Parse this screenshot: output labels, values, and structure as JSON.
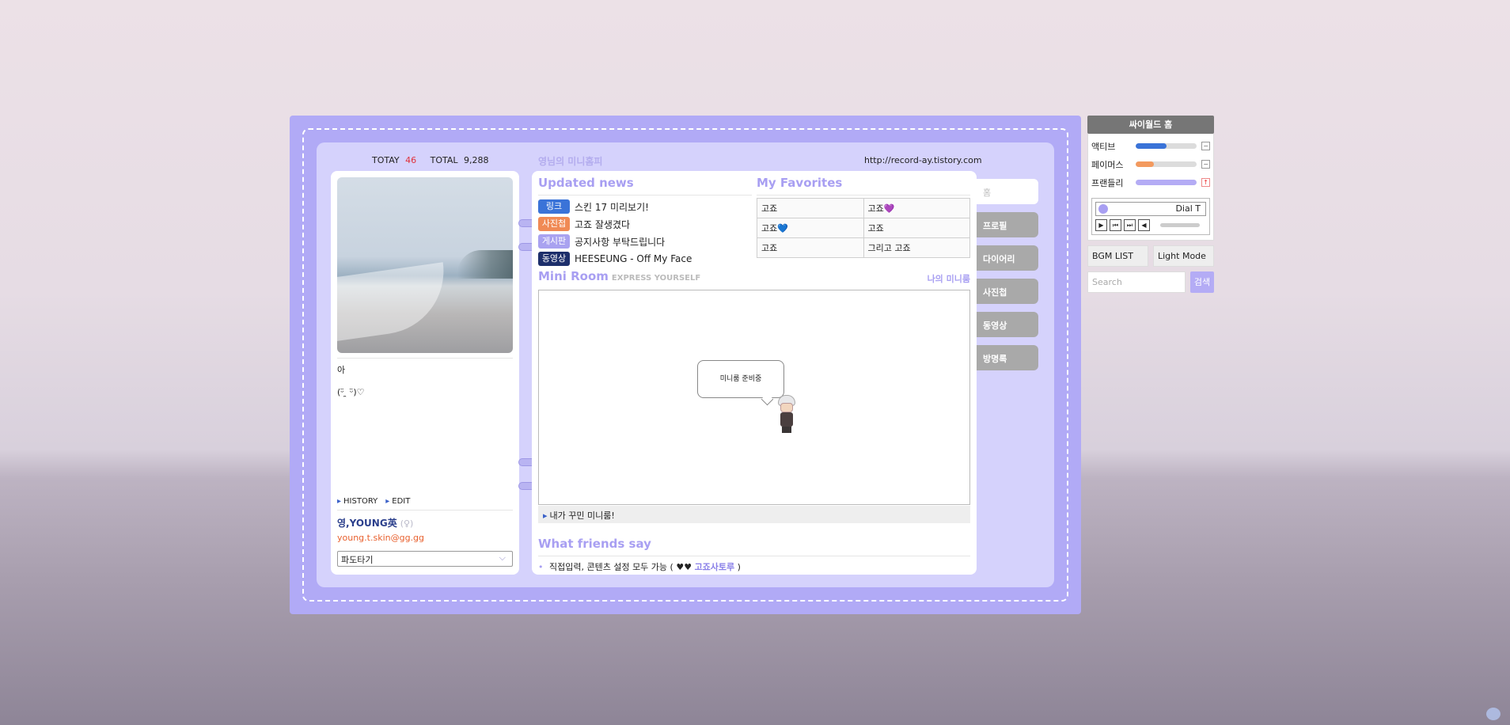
{
  "counter": {
    "today_label": "TOTAY",
    "today_value": "46",
    "total_label": "TOTAL",
    "total_value": "9,288"
  },
  "site_title": "영님의 미니홈피",
  "site_url": "http://record-ay.tistory.com",
  "profile": {
    "line1": "아",
    "line2": "(ᵕ̈  ̯ ᵕ̈)♡",
    "links": {
      "history": "HISTORY",
      "edit": "EDIT"
    },
    "name": "영,YOUNG英",
    "name_symbol": "(♀)",
    "email": "young.t.skin@gg.gg",
    "family_select": "파도타기"
  },
  "updated_news": {
    "title": "Updated news",
    "items": [
      {
        "badge": "링크",
        "badge_color": "#3a73d8",
        "text": "스킨 17 미리보기!"
      },
      {
        "badge": "사진첩",
        "badge_color": "#f08a55",
        "text": "고죠 잘생겼다"
      },
      {
        "badge": "게시판",
        "badge_color": "#a9a2f0",
        "text": "공지사항 부탁드립니다"
      },
      {
        "badge": "동영상",
        "badge_color": "#1d2f6b",
        "text": "HEESEUNG - Off My Face"
      }
    ]
  },
  "favorites": {
    "title": "My Favorites",
    "rows": [
      [
        "고죠",
        "고죠💜"
      ],
      [
        "고죠💙",
        "고죠"
      ],
      [
        "고죠",
        "그리고 고죠"
      ]
    ]
  },
  "miniroom": {
    "title": "Mini Room",
    "subtitle": "EXPRESS YOURSELF",
    "link": "나의 미니룸",
    "bubble": "미니룸 준비중",
    "caption": "내가 꾸민 미니룸!"
  },
  "friends": {
    "title": "What friends say",
    "item_text": "직접입력, 콘텐츠 설정 모두 가능 ( ♥♥",
    "item_author": "고죠사토루",
    "item_close": ")"
  },
  "tabs": [
    "홈",
    "프로필",
    "다이어리",
    "사진첩",
    "동영상",
    "방명록"
  ],
  "widget": {
    "title": "싸이월드 홈",
    "stats": [
      {
        "label": "액티브",
        "level": 0.5,
        "color": "#3a73d8",
        "btn": "−"
      },
      {
        "label": "페이머스",
        "level": 0.3,
        "color": "#f39a5f",
        "btn": "−"
      },
      {
        "label": "프랜들리",
        "level": 1.0,
        "color": "#b4acf5",
        "btn": "↑"
      }
    ],
    "player_track": "Dial T",
    "bgm_list": "BGM LIST",
    "light_mode": "Light Mode",
    "search_placeholder": "Search",
    "search_button": "검색"
  }
}
